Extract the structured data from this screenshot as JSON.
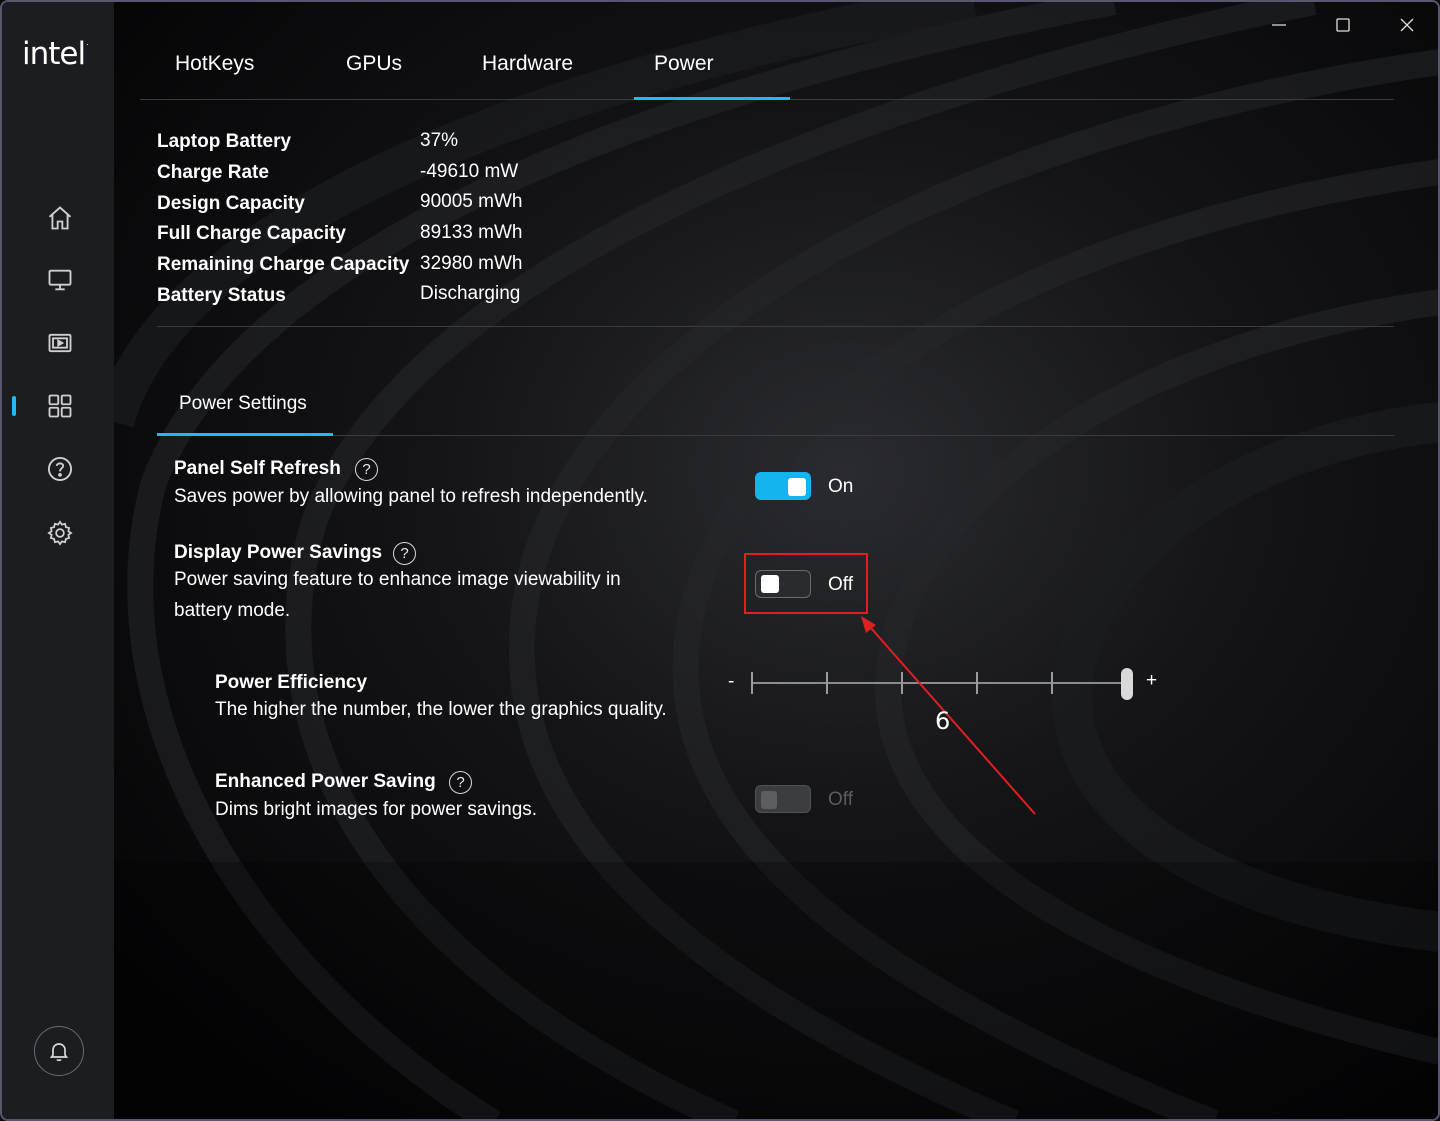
{
  "brand": {
    "logo_text": "intel"
  },
  "window_controls": {
    "minimize": "minimize-icon",
    "maximize": "maximize-icon",
    "close": "close-icon"
  },
  "sidebar": {
    "items": [
      {
        "icon": "home-icon"
      },
      {
        "icon": "display-icon"
      },
      {
        "icon": "video-icon"
      },
      {
        "icon": "apps-grid-icon",
        "active": true
      },
      {
        "icon": "help-icon"
      },
      {
        "icon": "gear-icon"
      }
    ],
    "bell_icon": "bell-icon"
  },
  "tabs": [
    {
      "label": "HotKeys"
    },
    {
      "label": "GPUs"
    },
    {
      "label": "Hardware"
    },
    {
      "label": "Power",
      "active": true
    }
  ],
  "battery": {
    "laptop_battery_label": "Laptop Battery",
    "laptop_battery_value": "37%",
    "charge_rate_label": "Charge Rate",
    "charge_rate_value": "-49610 mW",
    "design_capacity_label": "Design Capacity",
    "design_capacity_value": "90005 mWh",
    "full_charge_capacity_label": "Full Charge Capacity",
    "full_charge_capacity_value": "89133 mWh",
    "remaining_charge_capacity_label": "Remaining Charge Capacity",
    "remaining_charge_capacity_value": "32980 mWh",
    "battery_status_label": "Battery Status",
    "battery_status_value": "Discharging"
  },
  "power_settings": {
    "tab_label": "Power Settings",
    "panel_self_refresh": {
      "title": "Panel Self Refresh",
      "help": "?",
      "description": "Saves power by allowing panel to refresh independently.",
      "state_label": "On",
      "enabled": true
    },
    "display_power_savings": {
      "title": "Display Power Savings",
      "help": "?",
      "description": "Power saving feature to enhance image viewability in battery mode.",
      "state_label": "Off",
      "enabled": false
    },
    "power_efficiency": {
      "title": "Power Efficiency",
      "description": "The higher the number, the lower the graphics quality.",
      "minus_label": "-",
      "plus_label": "+",
      "slider_value": 6,
      "slider_min": 1,
      "slider_max": 6
    },
    "enhanced_power_saving": {
      "title": "Enhanced Power Saving",
      "help": "?",
      "description": "Dims bright images for power savings.",
      "state_label": "Off",
      "enabled": false,
      "disabled": true
    }
  },
  "annotation": {
    "label": "6",
    "color": "#e02020"
  },
  "colors": {
    "accent": "#13b4f0",
    "highlight": "#e02020",
    "sidebar_bg": "#1c1d20"
  }
}
